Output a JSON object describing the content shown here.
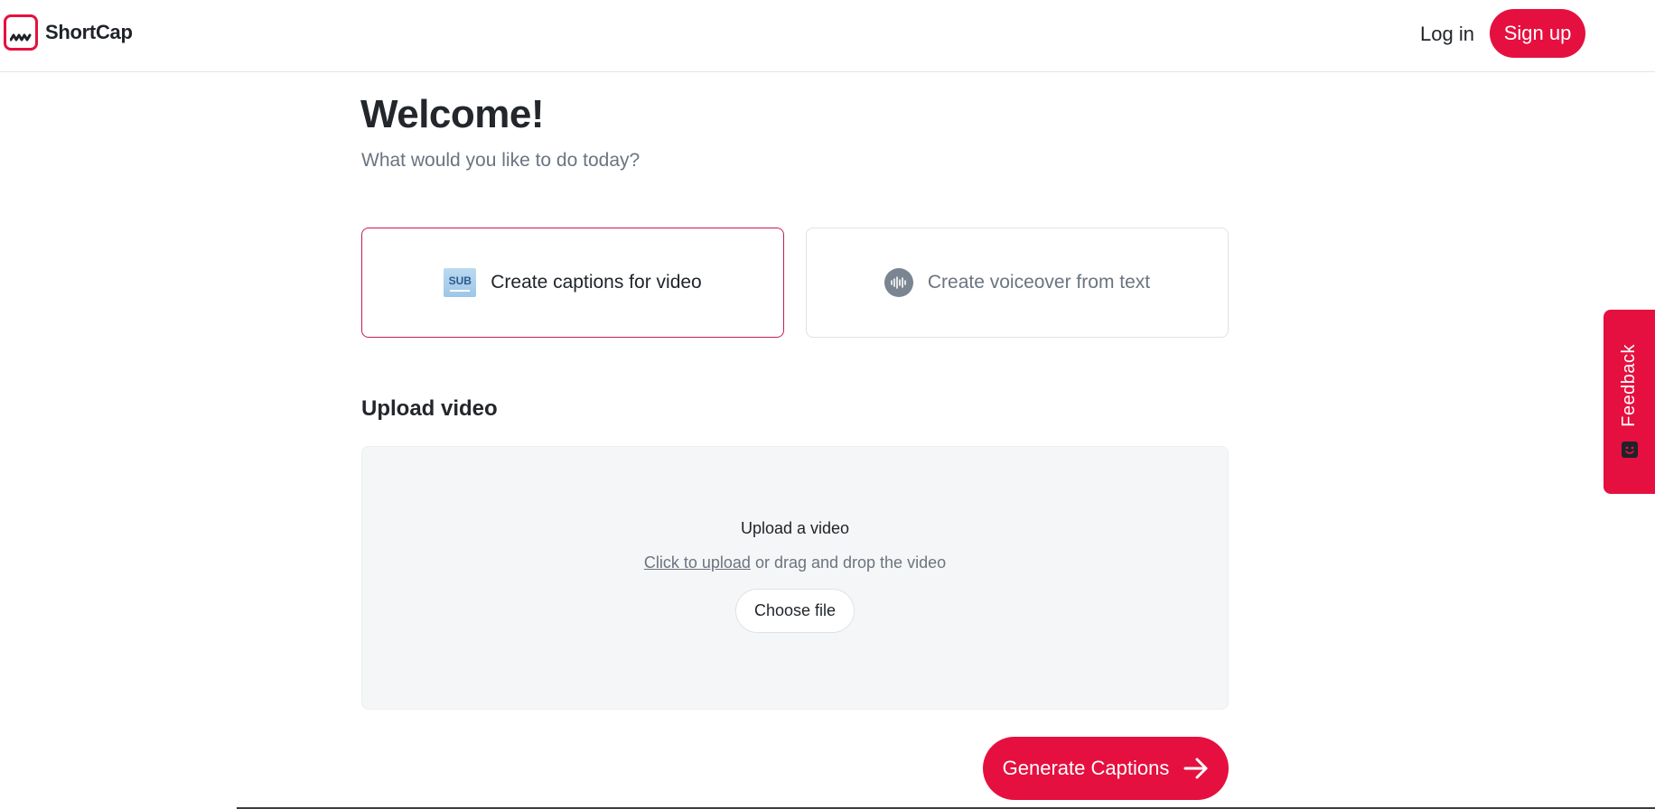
{
  "brand": {
    "name": "ShortCap",
    "accent_color": "#e5103f"
  },
  "header": {
    "login_label": "Log in",
    "signup_label": "Sign up"
  },
  "main": {
    "title": "Welcome!",
    "subtitle": "What would you like to do today?",
    "options": [
      {
        "label": "Create captions for video",
        "icon": "sub-icon",
        "icon_text": "SUB",
        "selected": true
      },
      {
        "label": "Create voiceover from text",
        "icon": "audio-wave-icon",
        "selected": false
      }
    ],
    "upload": {
      "section_title": "Upload video",
      "title": "Upload a video",
      "link_text": "Click to upload",
      "hint_rest": " or drag and drop the video",
      "choose_label": "Choose file"
    },
    "generate_label": "Generate Captions"
  },
  "feedback": {
    "label": "Feedback"
  }
}
